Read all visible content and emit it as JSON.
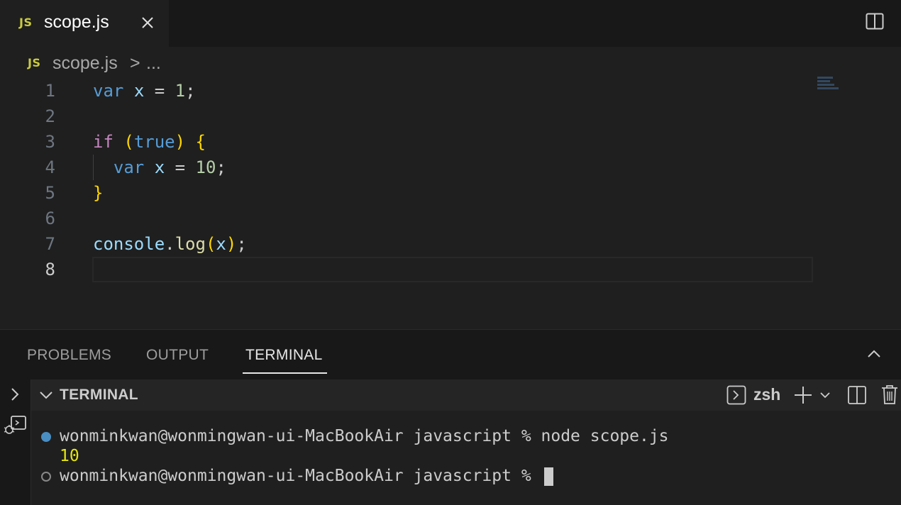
{
  "tab": {
    "badge": "JS",
    "label": "scope.js"
  },
  "breadcrumb": {
    "badge": "JS",
    "file": "scope.js",
    "separator": ">",
    "more": "..."
  },
  "editor": {
    "line_numbers": [
      "1",
      "2",
      "3",
      "4",
      "5",
      "6",
      "7",
      "8"
    ],
    "lines": {
      "l1": {
        "kw": "var",
        "ident": "x",
        "eq": " = ",
        "num": "1",
        "semi": ";"
      },
      "l3": {
        "kw": "if",
        "open": "(",
        "val": "true",
        "close": ")",
        "brace": "{"
      },
      "l4": {
        "kw": "var",
        "ident": "x",
        "eq": " = ",
        "num": "10",
        "semi": ";"
      },
      "l5": {
        "brace": "}"
      },
      "l7": {
        "obj": "console",
        "dot": ".",
        "fn": "log",
        "open": "(",
        "arg": "x",
        "close": ")",
        "semi": ";"
      }
    }
  },
  "panel": {
    "tabs": [
      "PROBLEMS",
      "OUTPUT",
      "TERMINAL"
    ],
    "active_tab": "TERMINAL"
  },
  "terminal": {
    "title": "TERMINAL",
    "shell": "zsh",
    "lines": [
      "wonminkwan@wonmingwan-ui-MacBookAir javascript % node scope.js",
      "10",
      "wonminkwan@wonmingwan-ui-MacBookAir javascript % "
    ]
  },
  "colors": {
    "editor_bg": "#1f1f1f",
    "keyword_blue": "#569cd6",
    "keyword_purple": "#c586c0",
    "identifier": "#9cdcfe",
    "number": "#b5cea8",
    "function": "#dcdcaa",
    "output_yellow": "#e5e510",
    "js_badge": "#cbcb41"
  }
}
